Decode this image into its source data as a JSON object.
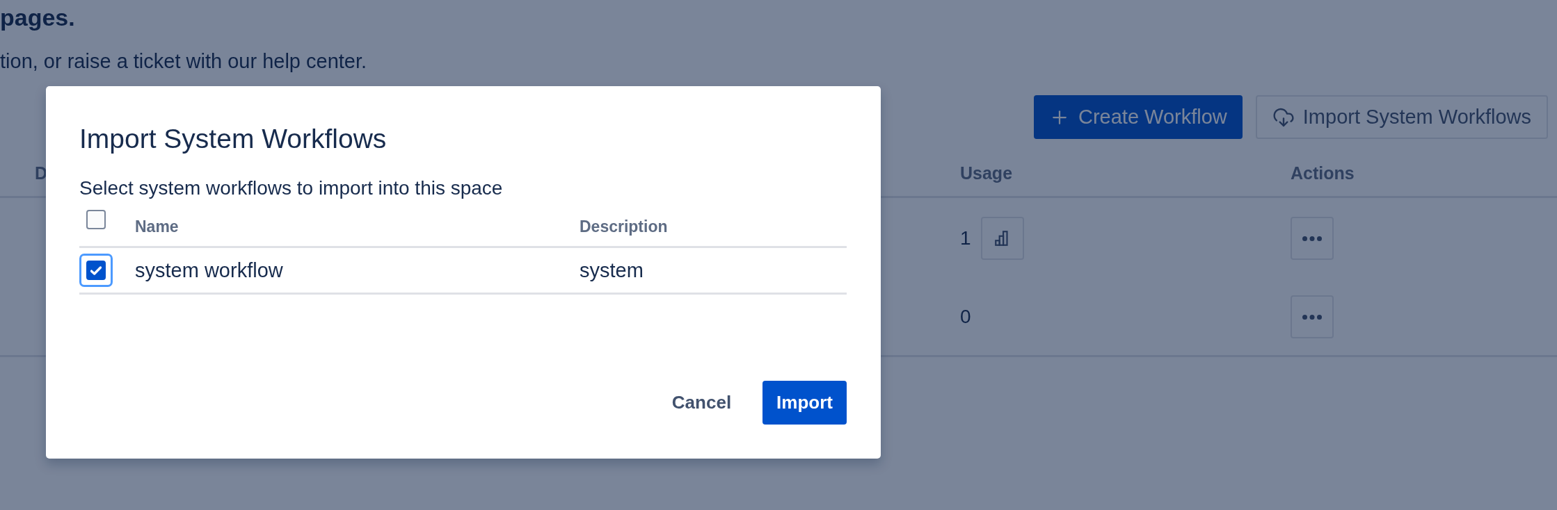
{
  "page": {
    "heading": "pages.",
    "text": "tion, or raise a ticket with our help center.",
    "actions": [
      {
        "kind": "primary",
        "label": "Create Workflow"
      },
      {
        "kind": "secondary",
        "label": "Import System Workflows"
      }
    ],
    "table": {
      "columns": [
        "D",
        "Usage",
        "Actions"
      ],
      "rows": [
        {
          "usage": "1",
          "usage_chart": true
        },
        {
          "usage": "0",
          "usage_chart": false
        }
      ]
    }
  },
  "modal": {
    "title": "Import System Workflows",
    "subtitle": "Select system workflows to import into this space",
    "all_checked": false,
    "columns": [
      "Name",
      "Description"
    ],
    "rows": [
      {
        "name": "system workflow",
        "description": "system",
        "checked": true,
        "focused": true
      }
    ],
    "buttons": [
      {
        "kind": "subtle",
        "label": "Cancel"
      },
      {
        "kind": "primary",
        "label": "Import"
      }
    ]
  }
}
